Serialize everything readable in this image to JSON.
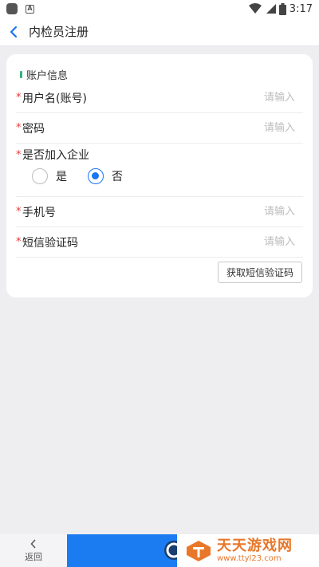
{
  "status_bar": {
    "time": "3:17",
    "notif_letter": "A"
  },
  "header": {
    "title": "内检员注册"
  },
  "form": {
    "section_title": "账户信息",
    "required_mark": "*",
    "username": {
      "label": "用户名(账号)",
      "placeholder": "请输入"
    },
    "password": {
      "label": "密码",
      "placeholder": "请输入"
    },
    "join_company": {
      "label": "是否加入企业",
      "options": [
        "是",
        "否"
      ],
      "selected": "否"
    },
    "phone": {
      "label": "手机号",
      "placeholder": "请输入"
    },
    "sms_code": {
      "label": "短信验证码",
      "placeholder": "请输入"
    },
    "get_code_button": "获取短信验证码"
  },
  "bottom_nav": {
    "back_label": "返回"
  },
  "watermark": {
    "name": "天天游戏网",
    "url": "www.ttyl23.com"
  },
  "colors": {
    "accent": "#1976f0",
    "required": "#e53935",
    "section_marker": "#36b37e",
    "watermark": "#e8772a"
  }
}
